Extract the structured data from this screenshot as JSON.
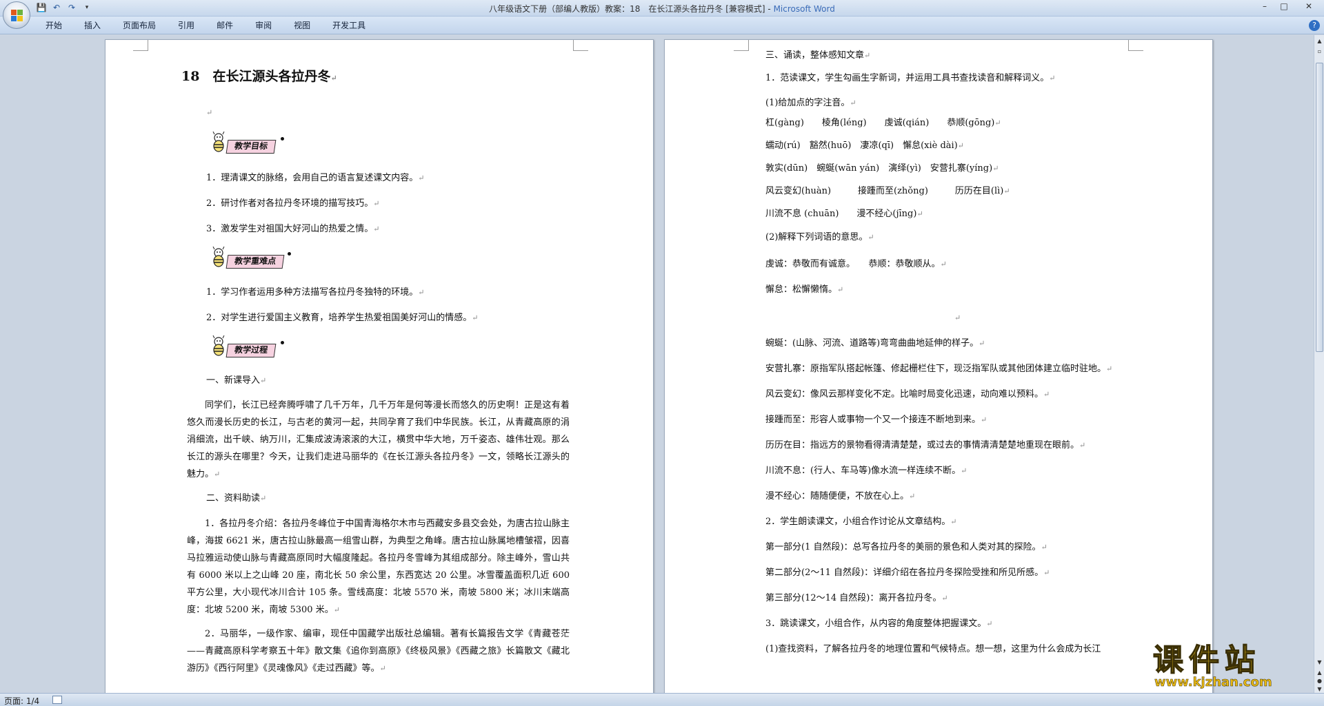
{
  "window": {
    "title_prefix": "八年级语文下册（部编人教版）教案：18　在长江源头各拉丹冬 [兼容模式] - ",
    "title_app": "Microsoft Word",
    "minimize": "–",
    "maximize": "□",
    "close": "✕"
  },
  "qat": {
    "save": "💾",
    "undo": "↶",
    "redo": "↷",
    "customize": "▾"
  },
  "ribbon": {
    "tabs": [
      "开始",
      "插入",
      "页面布局",
      "引用",
      "邮件",
      "审阅",
      "视图",
      "开发工具"
    ],
    "help": "?"
  },
  "left_page": {
    "title": "18　在长江源头各拉丹冬",
    "badges": [
      "教学目标",
      "教学重难点",
      "教学过程"
    ],
    "goals": [
      "1．理清课文的脉络，会用自己的语言复述课文内容。",
      "2．研讨作者对各拉丹冬环境的描写技巧。",
      "3．激发学生对祖国大好河山的热爱之情。"
    ],
    "difficulties": [
      "1．学习作者运用多种方法描写各拉丹冬独特的环境。",
      "2．对学生进行爱国主义教育，培养学生热爱祖国美好河山的情感。"
    ],
    "section1_heading": "一、新课导入",
    "section1_text": "同学们，长江已经奔腾呼啸了几千万年，几千万年是何等漫长而悠久的历史啊！正是这有着悠久而漫长历史的长江，与古老的黄河一起，共同孕育了我们中华民族。长江，从青藏高原的涓涓细流，出千峡、纳万川，汇集成波涛滚滚的大江，横贯中华大地，万千姿态、雄伟壮观。那么长江的源头在哪里？今天，让我们走进马丽华的《在长江源头各拉丹冬》一文，领略长江源头的魅力。",
    "section2_heading": "二、资料助读",
    "section2_item1": "1．各拉丹冬介绍：各拉丹冬峰位于中国青海格尔木市与西藏安多县交会处，为唐古拉山脉主峰，海拔 6621 米，唐古拉山脉最高一组雪山群，为典型之角峰。唐古拉山脉属地槽皱褶，因喜马拉雅运动使山脉与青藏高原同时大幅度隆起。各拉丹冬雪峰为其组成部分。除主峰外，雪山共有 6000 米以上之山峰 20 座，南北长 50 余公里，东西宽达 20 公里。冰雪覆盖面积几近 600 平方公里，大小现代冰川合计 105 条。雪线高度：北坡 5570 米，南坡 5800 米；冰川末端高度：北坡 5200 米，南坡 5300 米。",
    "section2_item2": "2．马丽华，一级作家、编审，现任中国藏学出版社总编辑。著有长篇报告文学《青藏苍茫——青藏高原科学考察五十年》散文集《追你到高原》《终极风景》《西藏之旅》长篇散文《藏北游历》《西行阿里》《灵魂像风》《走过西藏》等。"
  },
  "right_page": {
    "lines": [
      "三、诵读，整体感知文章",
      "1．范读课文，学生勾画生字新词，并运用工具书查找读音和解释词义。",
      "(1)给加点的字注音。",
      "杠(gàng)　　棱角(léng)　　虔诚(qián)　　恭顺(gōng)",
      "蠕动(rú)　豁然(huō)　凄凉(qī)　懈怠(xiè dài)",
      "敦实(dūn)　蜿蜒(wān yán)　演绎(yì)　安营扎寨(yíng)",
      "风云变幻(huàn)　　　接踵而至(zhǒng)　　　历历在目(lì)",
      "川流不息 (chuān)　　漫不经心(jīng)",
      "(2)解释下列词语的意思。",
      "虔诚：恭敬而有诚意。　　恭顺：恭敬顺从。",
      "懈怠：松懈懒惰。",
      "",
      "蜿蜒：(山脉、河流、道路等)弯弯曲曲地延伸的样子。",
      "安营扎寨：原指军队搭起帐篷、修起栅栏住下，现泛指军队或其他团体建立临时驻地。",
      "风云变幻：像风云那样变化不定。比喻时局变化迅速，动向难以预料。",
      "接踵而至：形容人或事物一个又一个接连不断地到来。",
      "历历在目：指远方的景物看得清清楚楚，或过去的事情清清楚楚地重现在眼前。",
      "川流不息：(行人、车马等)像水流一样连续不断。",
      "漫不经心：随随便便，不放在心上。",
      "2．学生朗读课文，小组合作讨论从文章结构。",
      "第一部分(1 自然段)：总写各拉丹冬的美丽的景色和人类对其的探险。",
      "第二部分(2～11 自然段)：详细介绍在各拉丹冬探险受挫和所见所感。",
      "第三部分(12～14 自然段)：离开各拉丹冬。",
      "3．跳读课文，小组合作，从内容的角度整体把握课文。",
      "(1)查找资料，了解各拉丹冬的地理位置和气候特点。想一想，这里为什么会成为长江"
    ]
  },
  "status": {
    "page": "页面: 1/4"
  },
  "watermark": {
    "main": "课件站",
    "url": "www.kjzhan.com"
  },
  "marks": {
    "para": "↵"
  }
}
